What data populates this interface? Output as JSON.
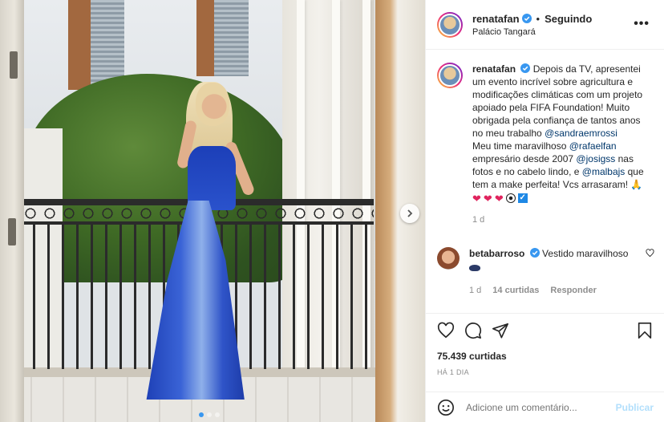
{
  "post": {
    "username": "renatafan",
    "follow_status": "Seguindo",
    "location": "Palácio Tangará",
    "more_glyph": "•••"
  },
  "caption": {
    "username": "renatafan",
    "segments": [
      "Depois da TV, apresentei um evento incrível sobre agricultura e modificações climáticas com um projeto apoiado pela FIFA Foundation! Muito obrigada pela confiança de tantos anos no meu trabalho ",
      "@sandraemrossi",
      " Meu time maravilhoso ",
      "@rafaelfan",
      " empresário desde 2007 ",
      "@josigss",
      " nas fotos e no cabelo lindo, e ",
      "@malbajs",
      " que tem a make perfeita! Vcs arrasaram! "
    ],
    "age": "1 d"
  },
  "comment": {
    "username": "betabarroso",
    "text": "Vestido maravilhoso",
    "age": "1 d",
    "likes": "14 curtidas",
    "reply": "Responder"
  },
  "icons": {
    "like": "heart-icon",
    "comment": "comment-icon",
    "share": "share-icon",
    "save": "bookmark-icon",
    "next": "chevron-right-icon",
    "emoji": "emoji-icon"
  },
  "stats": {
    "likes": "75.439 curtidas",
    "posted": "HÁ 1 DIA"
  },
  "add_comment": {
    "placeholder": "Adicione um comentário...",
    "publish": "Publicar"
  },
  "carousel": {
    "count": 3,
    "active": 1
  },
  "colors": {
    "verified": "#3897f0",
    "mention": "#00376b",
    "publish_disabled": "#b2dffc",
    "muted": "#8e8e8e"
  }
}
